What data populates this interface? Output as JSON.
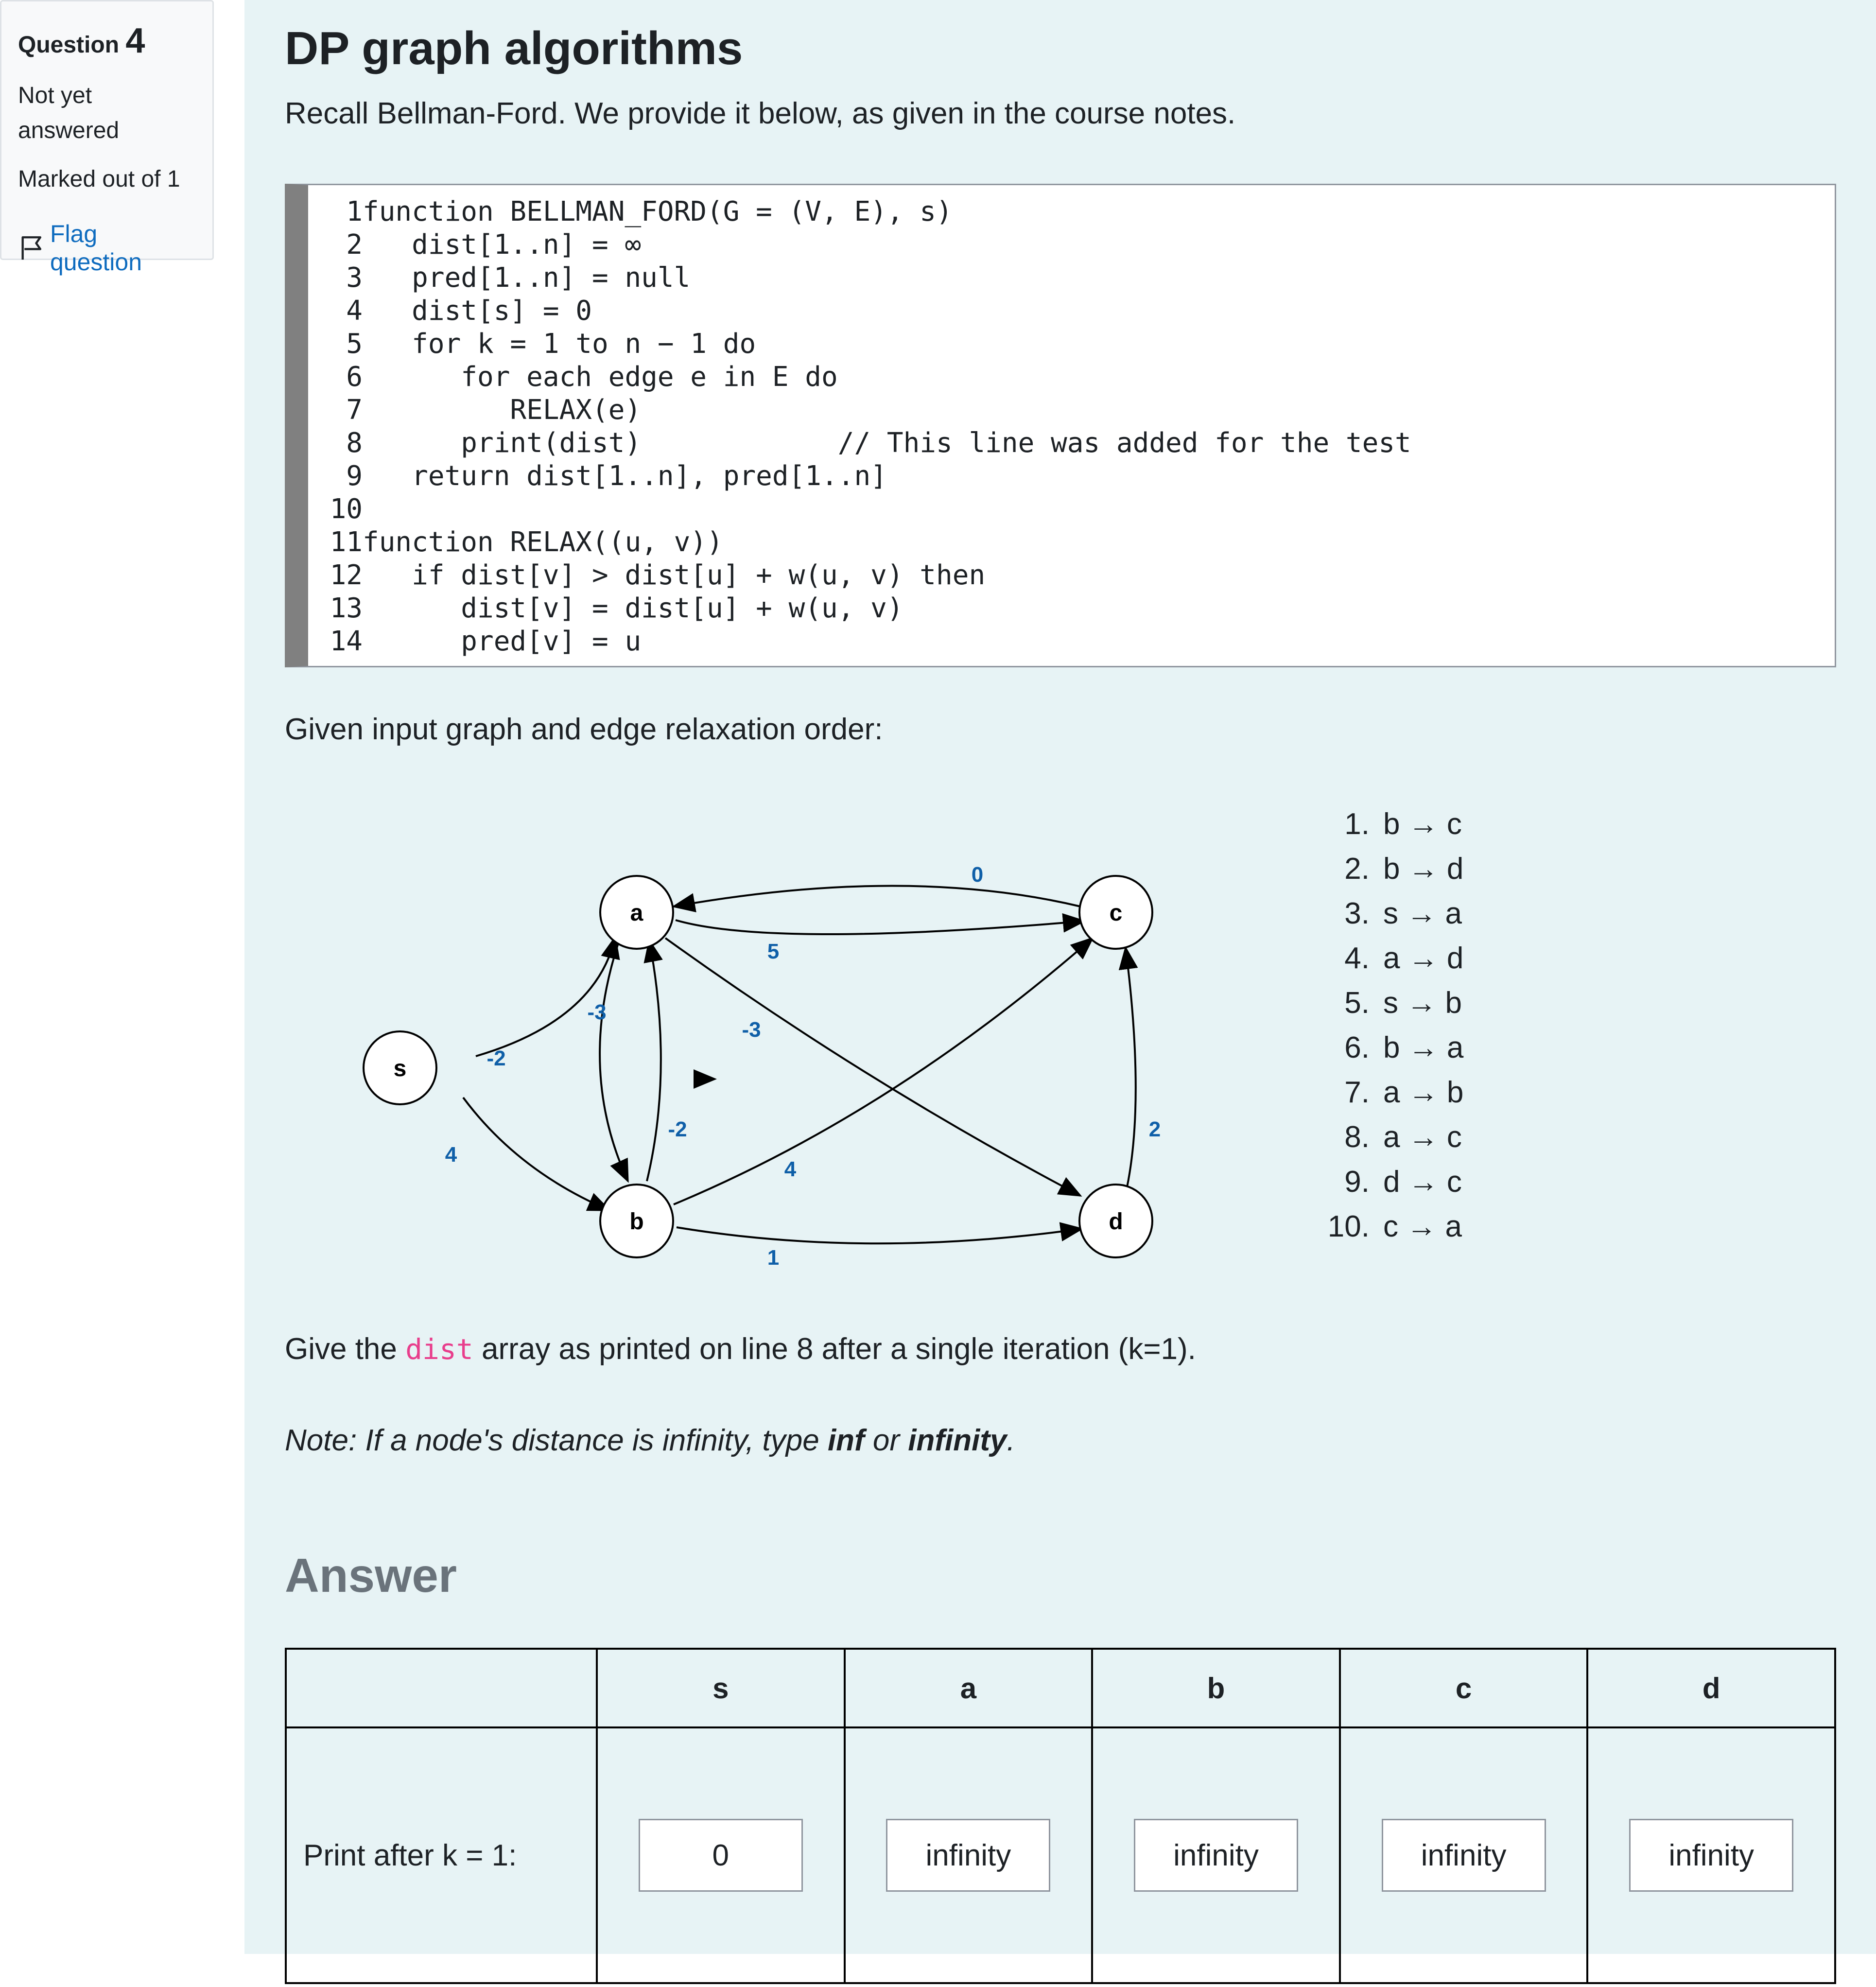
{
  "info": {
    "question_label": "Question",
    "question_number": "4",
    "state": "Not yet answered",
    "grade": "Marked out of 1",
    "flag_label": "Flag question"
  },
  "question": {
    "title": "DP graph algorithms",
    "intro": "Recall Bellman-Ford. We provide it below, as given in the course notes.",
    "code_lines": [
      {
        "n": "1",
        "text": "function BELLMAN_FORD(G = (V, E), s)"
      },
      {
        "n": "2",
        "text": "   dist[1..n] = ∞"
      },
      {
        "n": "3",
        "text": "   pred[1..n] = null"
      },
      {
        "n": "4",
        "text": "   dist[s] = 0"
      },
      {
        "n": "5",
        "text": "   for k = 1 to n − 1 do"
      },
      {
        "n": "6",
        "text": "      for each edge e in E do"
      },
      {
        "n": "7",
        "text": "         RELAX(e)"
      },
      {
        "n": "8",
        "text": "      print(dist)            // This line was added for the test"
      },
      {
        "n": "9",
        "text": "   return dist[1..n], pred[1..n]"
      },
      {
        "n": "10",
        "text": ""
      },
      {
        "n": "11",
        "text": "function RELAX((u, v))"
      },
      {
        "n": "12",
        "text": "   if dist[v] > dist[u] + w(u, v) then"
      },
      {
        "n": "13",
        "text": "      dist[v] = dist[u] + w(u, v)"
      },
      {
        "n": "14",
        "text": "      pred[v] = u"
      }
    ],
    "graph_intro": "Given input graph and edge relaxation order:",
    "graph": {
      "nodes": [
        "s",
        "a",
        "b",
        "c",
        "d"
      ],
      "edge_weights": {
        "c-a": "0",
        "a-c": "5",
        "a-b": "-3",
        "a-d": "-3",
        "s-a": "-2",
        "b-a": "-2",
        "s-b": "4",
        "b-c": "4",
        "b-d": "1",
        "d-c": "2"
      }
    },
    "relaxation_order": [
      {
        "n": "1.",
        "edge": "b → c"
      },
      {
        "n": "2.",
        "edge": "b → d"
      },
      {
        "n": "3.",
        "edge": "s → a"
      },
      {
        "n": "4.",
        "edge": "a → d"
      },
      {
        "n": "5.",
        "edge": "s → b"
      },
      {
        "n": "6.",
        "edge": "b → a"
      },
      {
        "n": "7.",
        "edge": "a → b"
      },
      {
        "n": "8.",
        "edge": "a → c"
      },
      {
        "n": "9.",
        "edge": "d → c"
      },
      {
        "n": "10.",
        "edge": "c → a"
      }
    ],
    "prompt_before": "Give the ",
    "prompt_code": "dist",
    "prompt_after": " array as printed on line 8 after a single iteration (k=1).",
    "note_prefix": "Note: If a node's distance is infinity, type ",
    "note_inf": "inf",
    "note_or": " or ",
    "note_infinity": "infinity",
    "note_suffix": "."
  },
  "answer": {
    "heading": "Answer",
    "columns": [
      "s",
      "a",
      "b",
      "c",
      "d"
    ],
    "row_label": "Print after k = 1:",
    "values": [
      "0",
      "infinity",
      "infinity",
      "infinity",
      "infinity"
    ]
  }
}
